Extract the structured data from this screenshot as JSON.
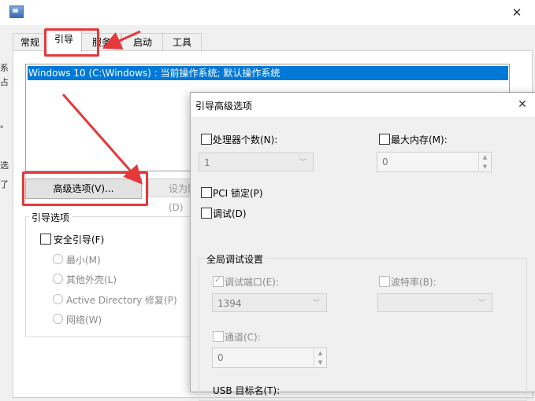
{
  "tabs": [
    {
      "label": "常规"
    },
    {
      "label": "引导"
    },
    {
      "label": "服务"
    },
    {
      "label": "启动"
    },
    {
      "label": "工具"
    }
  ],
  "os_list": {
    "items": [
      "Windows 10 (C:\\Windows) : 当前操作系统; 默认操作系统"
    ]
  },
  "buttons": {
    "advanced": "高级选项(V)...",
    "set_default": "设为默认值(D)"
  },
  "boot_options": {
    "title": "引导选项",
    "safe_boot": "安全引导(F)",
    "radios": [
      "最小(M)",
      "其他外壳(L)",
      "Active Directory 修复(P)",
      "网络(W)"
    ]
  },
  "left_edge_marks": [
    "系",
    "占",
    "。",
    "选",
    "区",
    "了"
  ],
  "advanced_dialog": {
    "title": "引导高级选项",
    "num_processors_label": "处理器个数(N):",
    "num_processors_value": "1",
    "max_memory_label": "最大内存(M):",
    "max_memory_value": "0",
    "pci_lock_label": "PCI 锁定(P)",
    "debug_label": "调试(D)",
    "global_debug_title": "全局调试设置",
    "debug_port_label": "调试端口(E):",
    "debug_port_value": "1394",
    "baud_rate_label": "波特率(B):",
    "baud_rate_value": "",
    "channel_label": "通道(C):",
    "channel_value": "0",
    "usb_target_label": "USB 目标名(T):"
  },
  "icons": {
    "chevron": "chevron-down-icon",
    "close": "close-icon",
    "check": "checkmark-icon"
  },
  "colors": {
    "selection": "#0078d7",
    "annotation": "#e5383b"
  }
}
